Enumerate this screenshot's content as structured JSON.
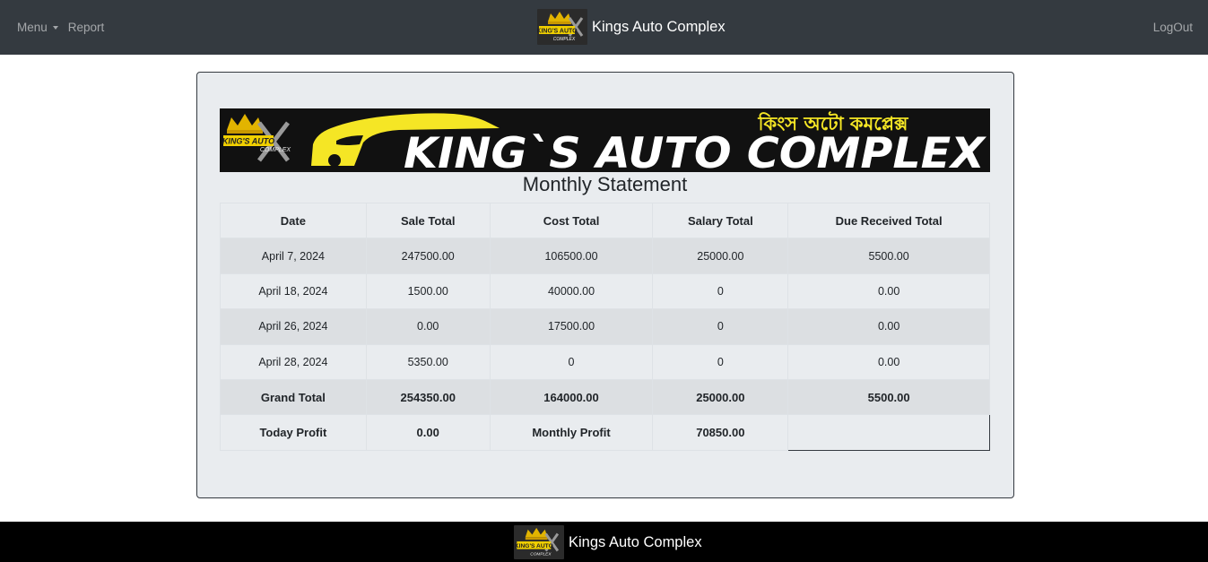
{
  "nav": {
    "menu_label": "Menu",
    "report_label": "Report",
    "brand_name": "Kings Auto Complex",
    "logout_label": "LogOut"
  },
  "banner": {
    "logo_text_top": "KING'S AUTO",
    "logo_text_bottom": "COMPLEX",
    "title": "KING`S AUTO COMPLEX",
    "bengali_title": "কিংস অটো কমপ্লেক্স",
    "accent_color": "#f5e625"
  },
  "statement": {
    "title": "Monthly Statement",
    "columns": [
      "Date",
      "Sale Total",
      "Cost Total",
      "Salary Total",
      "Due Received Total"
    ],
    "rows": [
      [
        "April 7, 2024",
        "247500.00",
        "106500.00",
        "25000.00",
        "5500.00"
      ],
      [
        "April 18, 2024",
        "1500.00",
        "40000.00",
        "0",
        "0.00"
      ],
      [
        "April 26, 2024",
        "0.00",
        "17500.00",
        "0",
        "0.00"
      ],
      [
        "April 28, 2024",
        "5350.00",
        "0",
        "0",
        "0.00"
      ]
    ],
    "grand_total": [
      "Grand Total",
      "254350.00",
      "164000.00",
      "25000.00",
      "5500.00"
    ],
    "profit_row": [
      "Today Profit",
      "0.00",
      "Monthly Profit",
      "70850.00"
    ]
  },
  "footer": {
    "brand_name": "Kings Auto Complex"
  },
  "colors": {
    "navbar_bg": "#343a40",
    "card_bg": "#e9ecef",
    "footer_bg": "#000000"
  }
}
